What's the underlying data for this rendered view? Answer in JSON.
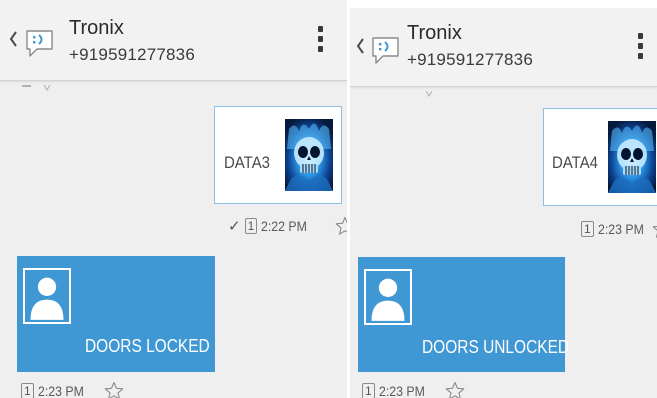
{
  "left": {
    "header": {
      "contact_name": "Tronix",
      "contact_number": "+919591277836",
      "back_icon": "chevron-left-icon",
      "app_icon": "messaging-smiley-icon",
      "menu_icon": "overflow-menu-icon"
    },
    "outgoing": {
      "text": "DATA3",
      "image": "blue-flaming-skull-thumbnail"
    },
    "outgoing_meta": {
      "status_icon": "✓",
      "sim": "1",
      "time": "2:22 PM",
      "star_icon": "star-outline-icon"
    },
    "incoming": {
      "text": "DOORS LOCKED",
      "image": "contact-placeholder-icon"
    },
    "incoming_meta": {
      "sim": "1",
      "time": "2:23 PM",
      "star_icon": "star-outline-icon"
    }
  },
  "right": {
    "header": {
      "contact_name": "Tronix",
      "contact_number": "+919591277836",
      "back_icon": "chevron-left-icon",
      "app_icon": "messaging-smiley-icon",
      "menu_icon": "overflow-menu-icon"
    },
    "outgoing": {
      "text": "DATA4",
      "image": "blue-flaming-skull-thumbnail"
    },
    "outgoing_meta": {
      "sim": "1",
      "time": "2:23 PM",
      "star_icon": "star-outline-icon"
    },
    "incoming": {
      "text": "DOORS UNLOCKED",
      "image": "contact-placeholder-icon"
    },
    "incoming_meta": {
      "sim": "1",
      "time": "2:23 PM",
      "star_icon": "star-outline-icon"
    }
  },
  "colors": {
    "incoming_bubble": "#3f97d3",
    "outgoing_border": "#8fbfe0",
    "background": "#efefef"
  }
}
